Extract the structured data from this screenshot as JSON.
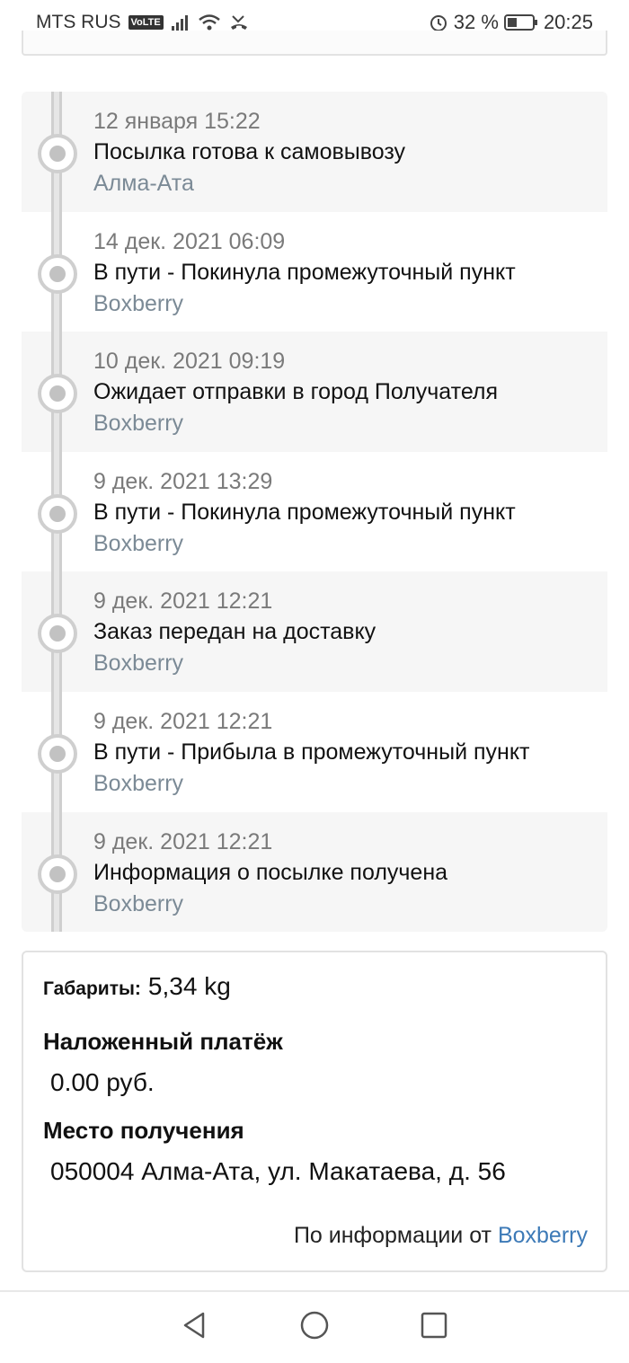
{
  "status_bar": {
    "carrier": "MTS RUS",
    "volte": "VoLTE",
    "battery_percent": "32 %",
    "time": "20:25"
  },
  "events": [
    {
      "date": "12 января 15:22",
      "title": "Посылка готова к самовывозу",
      "place": "Алма-Ата"
    },
    {
      "date": "14 дек. 2021 06:09",
      "title": "В пути - Покинула промежуточный пункт",
      "place": "Boxberry"
    },
    {
      "date": "10 дек. 2021 09:19",
      "title": "Ожидает отправки в город Получателя",
      "place": "Boxberry"
    },
    {
      "date": "9 дек. 2021 13:29",
      "title": "В пути - Покинула промежуточный пункт",
      "place": "Boxberry"
    },
    {
      "date": "9 дек. 2021 12:21",
      "title": "Заказ передан на доставку",
      "place": "Boxberry"
    },
    {
      "date": "9 дек. 2021 12:21",
      "title": "В пути - Прибыла в промежуточный пункт",
      "place": "Boxberry"
    },
    {
      "date": "9 дек. 2021 12:21",
      "title": "Информация о посылке получена",
      "place": "Boxberry"
    }
  ],
  "details": {
    "dimensions_label": "Габариты:",
    "dimensions_value": "5,34 kg",
    "cod_label": "Наложенный платёж",
    "cod_value": "0.00 руб.",
    "pickup_label": "Место получения",
    "pickup_value": "050004 Алма-Ата, ул. Макатаева, д. 56",
    "source_prefix": "По информации от",
    "source_link": "Boxberry"
  },
  "colors": {
    "link": "#3d7ab7",
    "timeline": "#cfcfcf"
  }
}
